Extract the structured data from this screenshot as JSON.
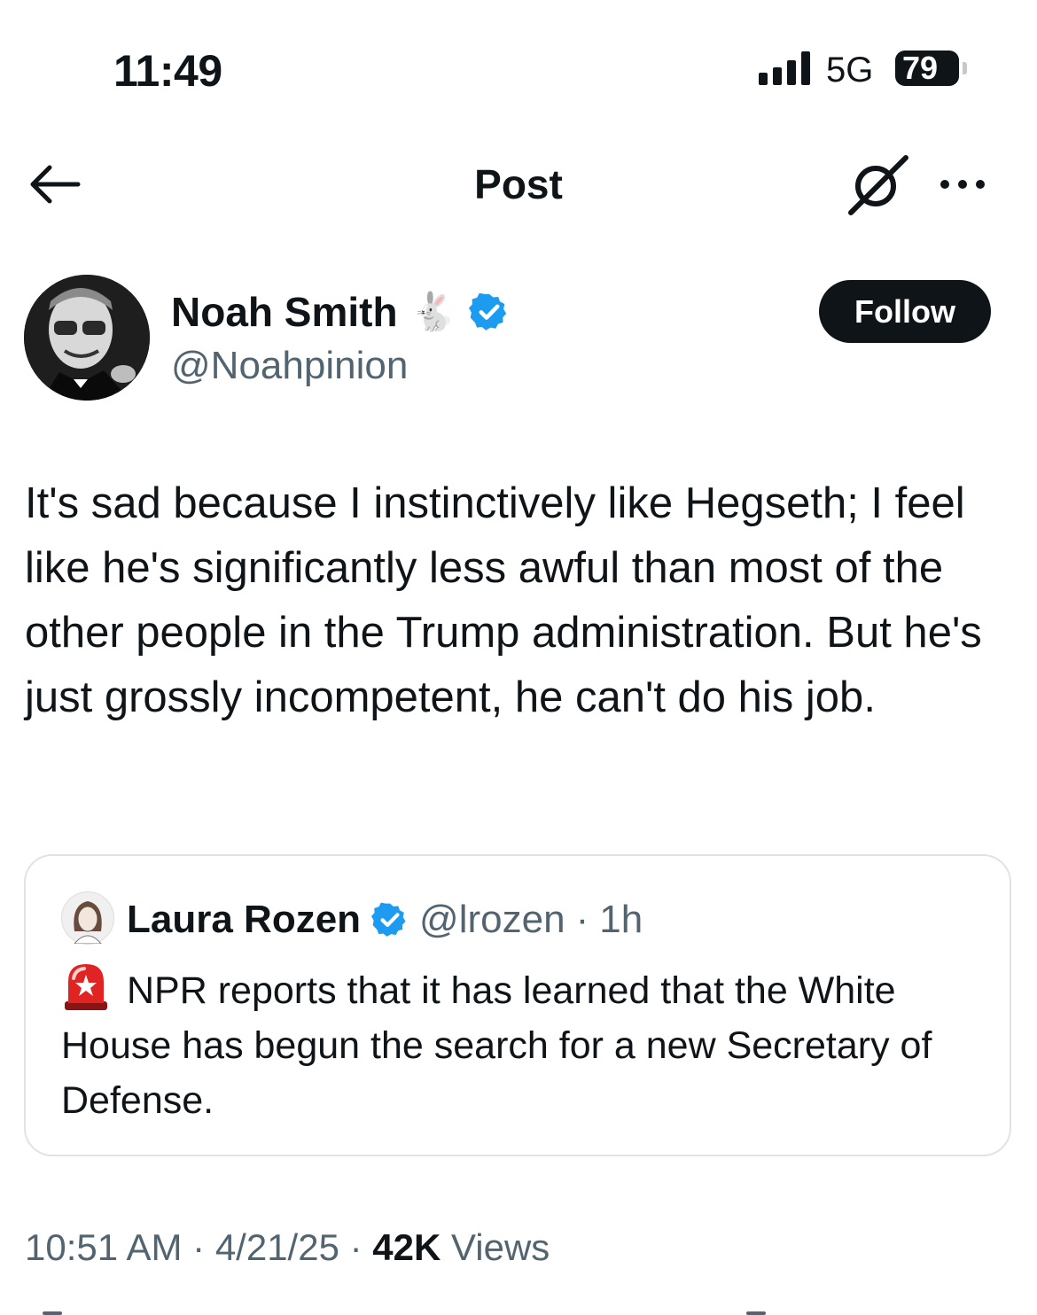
{
  "status_bar": {
    "time": "11:49",
    "network": "5G",
    "battery": "79"
  },
  "nav": {
    "title": "Post",
    "back_icon": "arrow-left-icon",
    "grok_icon": "grok-icon",
    "more_icon": "ellipsis-icon"
  },
  "author": {
    "name": "Noah Smith",
    "emoji": "🐇",
    "handle": "@Noahpinion",
    "verified": true,
    "follow_label": "Follow"
  },
  "post": {
    "text": "It's sad because I instinctively like Hegseth; I feel like he's significantly less awful than most of the other people in the Trump administration. But he's just grossly incompetent, he can't do his job."
  },
  "quote": {
    "name": "Laura Rozen",
    "handle": "@lrozen",
    "separator": "·",
    "age": "1h",
    "siren_icon": "siren-icon",
    "text": "NPR reports that it has learned that the White House has begun the search for a new Secretary of Defense."
  },
  "meta": {
    "time": "10:51 AM",
    "date": "4/21/25",
    "dot": "·",
    "views_count": "42K",
    "views_label": "Views"
  },
  "colors": {
    "text": "#0f1419",
    "secondary": "#536471",
    "verified": "#1d9bf0",
    "border": "#dfe3e6"
  }
}
